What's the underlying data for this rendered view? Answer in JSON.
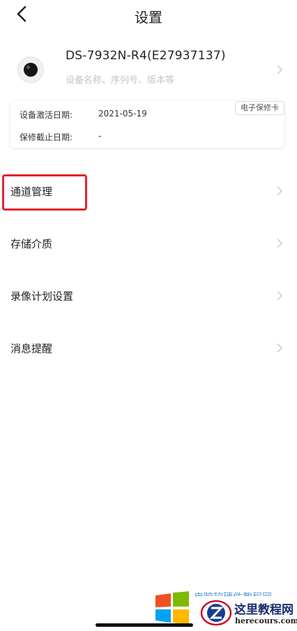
{
  "header": {
    "title": "设置",
    "back_icon": "chevron-left-icon"
  },
  "device": {
    "name": "DS-7932N-R4(E27937137)",
    "subtitle": "设备名称、序列号、版本等"
  },
  "warranty_card": {
    "badge": "电子保修卡",
    "rows": [
      {
        "label": "设备激活日期:",
        "value": "2021-05-19"
      },
      {
        "label": "保修截止日期:",
        "value": "-"
      }
    ]
  },
  "menu": [
    {
      "label": "通道管理",
      "highlighted": true
    },
    {
      "label": "存储介质"
    },
    {
      "label": "录像计划设置"
    },
    {
      "label": "消息提醒"
    }
  ],
  "watermark": {
    "title": "这里教程网",
    "url": "herecours.com",
    "overline": "电脑软硬件教程网"
  },
  "colors": {
    "highlight": "#e3262b",
    "chevron": "#cccccc",
    "subtitle": "#c4c4c4"
  }
}
